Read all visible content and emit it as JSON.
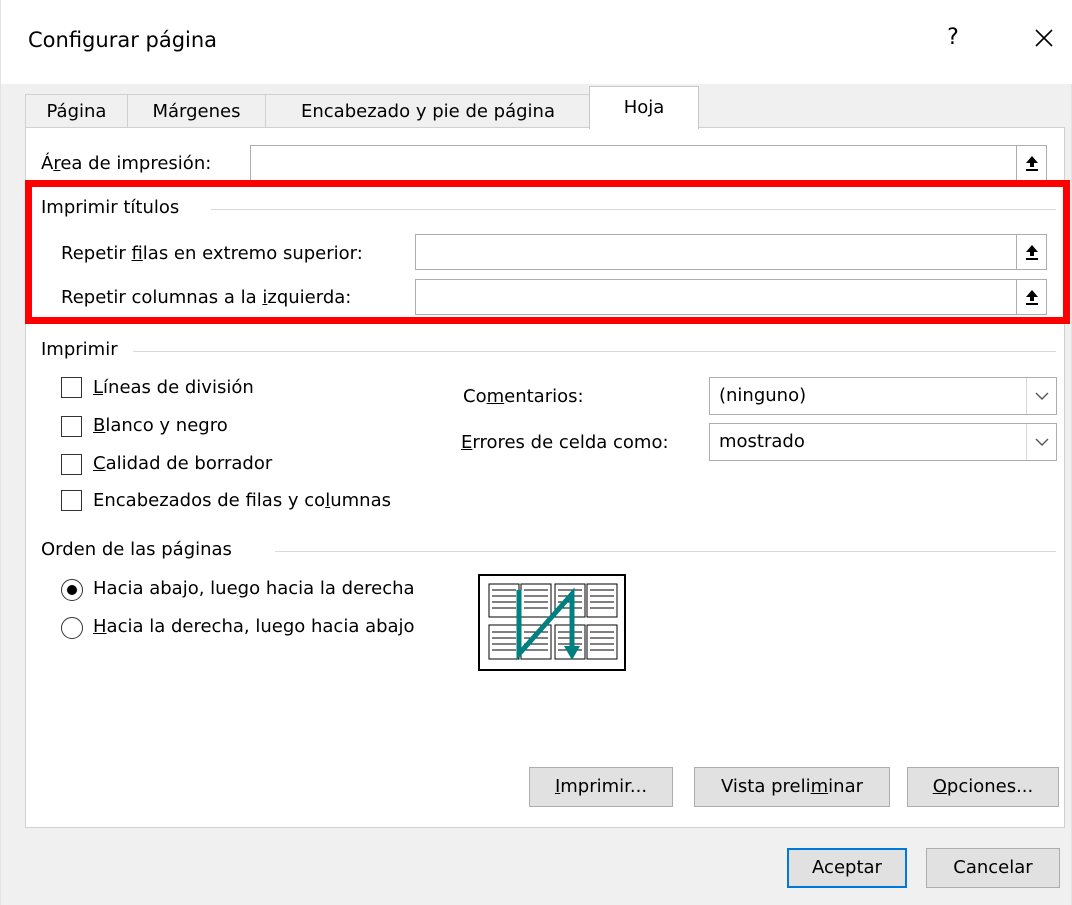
{
  "window": {
    "title": "Configurar página",
    "help_label": "?",
    "close_icon": "close-icon"
  },
  "tabs": [
    {
      "label": "Página",
      "active": false
    },
    {
      "label": "Márgenes",
      "active": false
    },
    {
      "label": "Encabezado y pie de página",
      "active": false
    },
    {
      "label": "Hoja",
      "active": true
    }
  ],
  "print_area": {
    "label_pre": "Á",
    "label_u": "r",
    "label_post": "ea de impresión:",
    "value": ""
  },
  "print_titles": {
    "heading": "Imprimir títulos",
    "rows_label_pre": "Repetir ",
    "rows_label_u": "f",
    "rows_label_post": "ilas en extremo superior:",
    "rows_value": "",
    "cols_label_pre": "Repetir columnas a la ",
    "cols_label_u": "i",
    "cols_label_post": "zquierda:",
    "cols_value": "",
    "highlight_color": "#ff0000"
  },
  "print": {
    "heading": "Imprimir",
    "checkboxes": [
      {
        "pre": "",
        "u": "L",
        "post": "íneas de división",
        "checked": false
      },
      {
        "pre": "",
        "u": "B",
        "post": "lanco y negro",
        "checked": false
      },
      {
        "pre": "",
        "u": "C",
        "post": "alidad de borrador",
        "checked": false
      },
      {
        "pre": "Encabezados de filas y co",
        "u": "l",
        "post": "umnas",
        "checked": false
      }
    ],
    "comments_label_pre": "Co",
    "comments_label_u": "m",
    "comments_label_post": "entarios:",
    "comments_value": "(ninguno)",
    "errors_label_pre": "",
    "errors_label_u": "E",
    "errors_label_post": "rrores de celda como:",
    "errors_value": "mostrado"
  },
  "page_order": {
    "heading": "Orden de las páginas",
    "options": [
      {
        "pre": "Hacia abajo, lue",
        "u": "g",
        "post": "o hacia la derecha",
        "checked": true
      },
      {
        "pre": "",
        "u": "H",
        "post": "acia la derecha, luego hacia abajo",
        "checked": false
      }
    ],
    "arrow_color": "#008080"
  },
  "panel_buttons": {
    "print_pre": "",
    "print_u": "I",
    "print_post": "mprimir...",
    "preview_pre": "Vista preli",
    "preview_u": "m",
    "preview_post": "inar",
    "options_pre": "",
    "options_u": "O",
    "options_post": "pciones..."
  },
  "footer": {
    "ok_label": "Aceptar",
    "cancel_label": "Cancelar",
    "accent_color": "#0078d7"
  }
}
